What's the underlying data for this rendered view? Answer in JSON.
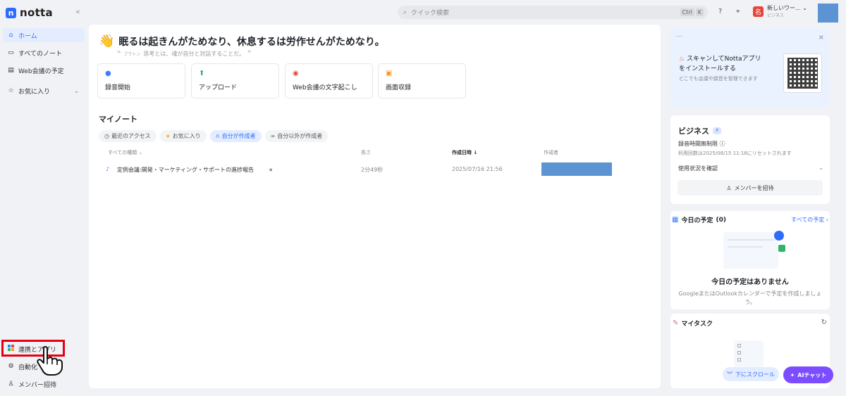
{
  "app": {
    "logo_text": "notta"
  },
  "sidebar": {
    "items": [
      {
        "label": "ホーム"
      },
      {
        "label": "すべてのノート"
      },
      {
        "label": "Web会議の予定"
      },
      {
        "label": "お気に入り"
      }
    ],
    "bottom_items": [
      {
        "label": "連携とアプリ"
      },
      {
        "label": "自動化"
      },
      {
        "label": "メンバー招待"
      }
    ]
  },
  "topbar": {
    "search_placeholder": "クイック検索",
    "shortcut": [
      "Ctrl",
      "K"
    ],
    "workspace_name": "新しいワー...",
    "workspace_plan": "ビジネス",
    "workspace_avatar": "名"
  },
  "greeting": {
    "title": "眠るは起きんがためなり、休息するは労作せんがためなり。",
    "author": "プラトン",
    "quote": "思考とは、魂が自分と対話することだ。"
  },
  "actions": [
    {
      "label": "録音開始",
      "color": "#3b7dff"
    },
    {
      "label": "アップロード",
      "color": "#2fb56a"
    },
    {
      "label": "Web会議の文字起こし",
      "color": "#e8453c"
    },
    {
      "label": "画面収録",
      "color": "#f59a23"
    }
  ],
  "notes": {
    "title": "マイノート",
    "filters": [
      {
        "label": "最近のアクセス"
      },
      {
        "label": "お気に入り"
      },
      {
        "label": "自分が作成者"
      },
      {
        "label": "自分以外が作成者"
      }
    ],
    "columns": [
      "すべての種類",
      "長さ",
      "作成日時",
      "作成者"
    ],
    "rows": [
      {
        "title": "定例会議:開発・マーケティング・サポートの進捗報告",
        "length": "2分49秒",
        "created": "2025/07/16 21:56"
      }
    ]
  },
  "promo": {
    "title_line1": "スキャンしてNottaアプリ",
    "title_line2": "をインストールする",
    "subtitle": "どこでも会議や録音を管理できます"
  },
  "plan": {
    "title": "ビジネス",
    "recording": "録音時間無制限",
    "reset_note": "利用回数は2025/08/15 11:18にリセットされます",
    "usage_link": "使用状況を確認",
    "invite_button": "メンバーを招待"
  },
  "schedule": {
    "title": "今日の予定",
    "count": "(0)",
    "all_link": "すべての予定",
    "empty_title": "今日の予定はありません",
    "empty_desc_line1": "GoogleまたはOutlookカレンダーで予定を作成しましょ",
    "empty_desc_line2": "う。"
  },
  "tasks": {
    "title": "マイタスク"
  },
  "floating": {
    "scroll_label": "下にスクロール",
    "ai_label": "AIチャット"
  }
}
